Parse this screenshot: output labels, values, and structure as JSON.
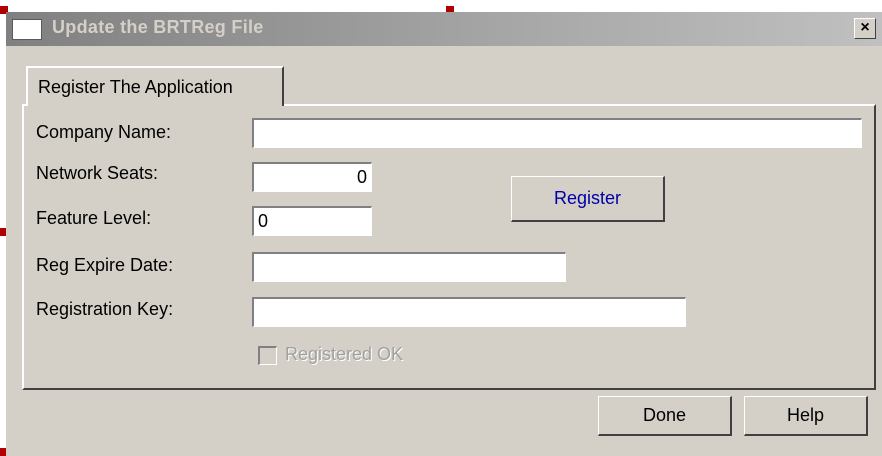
{
  "window": {
    "title": "Update the BRTReg File",
    "close_symbol": "×"
  },
  "tab": {
    "label": "Register The Application"
  },
  "form": {
    "company_name": {
      "label": "Company Name:",
      "value": ""
    },
    "network_seats": {
      "label": "Network Seats:",
      "value": "0"
    },
    "feature_level": {
      "label": "Feature Level:",
      "value": "0"
    },
    "reg_expire_date": {
      "label": "Reg Expire Date:",
      "value": ""
    },
    "registration_key": {
      "label": "Registration Key:",
      "value": ""
    },
    "registered_ok": {
      "label": "Registered OK",
      "checked": false,
      "enabled": false
    }
  },
  "buttons": {
    "register": "Register",
    "done": "Done",
    "help": "Help"
  },
  "colors": {
    "title_gradient_start": "#808080",
    "window_face": "#d4d0c8",
    "register_text": "#0000a8",
    "selection_handle": "#b00000"
  }
}
